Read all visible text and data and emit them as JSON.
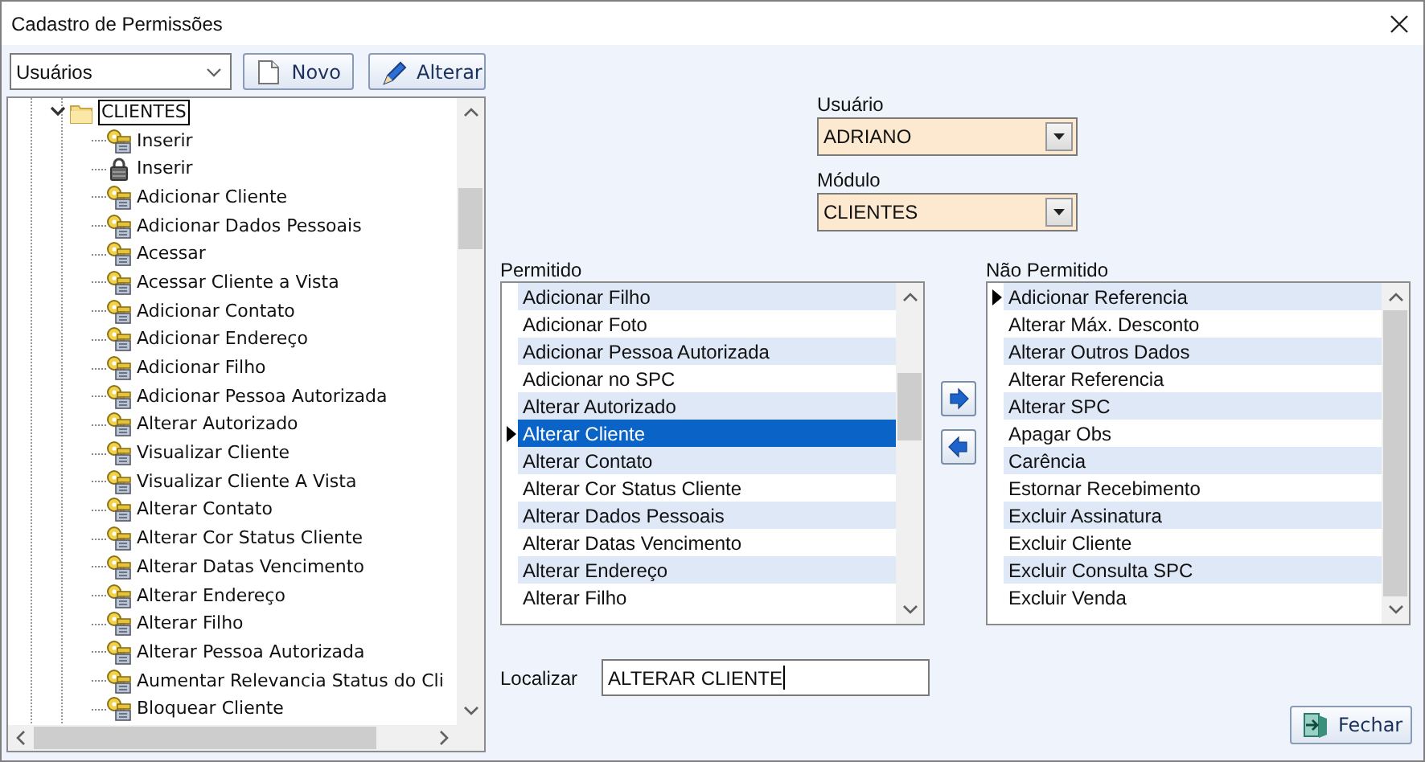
{
  "window": {
    "title": "Cadastro de Permissões"
  },
  "toolbar": {
    "type_combo": {
      "value": "Usuários"
    },
    "buttons": [
      {
        "label": "Novo",
        "kind": "new"
      },
      {
        "label": "Alterar",
        "kind": "edit"
      }
    ]
  },
  "tree": {
    "root": {
      "label": "CLIENTES",
      "expanded": true,
      "selected": true,
      "children": [
        {
          "label": "Inserir",
          "kind": "key",
          "selected": false
        },
        {
          "label": "Inserir",
          "kind": "lock",
          "selected": false
        },
        {
          "label": "Adicionar Cliente",
          "kind": "key",
          "selected": false
        },
        {
          "label": "Adicionar Dados Pessoais",
          "kind": "key",
          "selected": false
        },
        {
          "label": "Acessar",
          "kind": "key",
          "selected": false
        },
        {
          "label": "Acessar Cliente a Vista",
          "kind": "key",
          "selected": false
        },
        {
          "label": "Adicionar Contato",
          "kind": "key",
          "selected": false
        },
        {
          "label": "Adicionar Endereço",
          "kind": "key",
          "selected": false
        },
        {
          "label": "Adicionar Filho",
          "kind": "key",
          "selected": false
        },
        {
          "label": "Adicionar Pessoa Autorizada",
          "kind": "key",
          "selected": false
        },
        {
          "label": "Alterar Autorizado",
          "kind": "key",
          "selected": false
        },
        {
          "label": "Visualizar Cliente",
          "kind": "key",
          "selected": false
        },
        {
          "label": "Visualizar Cliente A Vista",
          "kind": "key",
          "selected": false
        },
        {
          "label": "Alterar Contato",
          "kind": "key",
          "selected": false
        },
        {
          "label": "Alterar Cor Status Cliente",
          "kind": "key",
          "selected": false
        },
        {
          "label": "Alterar Datas Vencimento",
          "kind": "key",
          "selected": false
        },
        {
          "label": "Alterar Endereço",
          "kind": "key",
          "selected": false
        },
        {
          "label": "Alterar Filho",
          "kind": "key",
          "selected": false
        },
        {
          "label": "Alterar Pessoa Autorizada",
          "kind": "key",
          "selected": false
        },
        {
          "label": "Aumentar Relevancia Status do Cli",
          "kind": "key",
          "selected": false
        },
        {
          "label": "Bloquear Cliente",
          "kind": "key",
          "selected": false
        }
      ]
    }
  },
  "usuario": {
    "label": "Usuário",
    "value": "ADRIANO"
  },
  "modulo": {
    "label": "Módulo",
    "value": "CLIENTES"
  },
  "permitido": {
    "label": "Permitido",
    "rows": [
      {
        "text": "Adicionar Filho",
        "selected": false,
        "current": false
      },
      {
        "text": "Adicionar Foto",
        "selected": false,
        "current": false
      },
      {
        "text": "Adicionar Pessoa Autorizada",
        "selected": false,
        "current": false
      },
      {
        "text": "Adicionar no SPC",
        "selected": false,
        "current": false
      },
      {
        "text": "Alterar Autorizado",
        "selected": false,
        "current": false
      },
      {
        "text": "Alterar Cliente",
        "selected": true,
        "current": true
      },
      {
        "text": "Alterar Contato",
        "selected": false,
        "current": false
      },
      {
        "text": "Alterar Cor Status Cliente",
        "selected": false,
        "current": false
      },
      {
        "text": "Alterar Dados Pessoais",
        "selected": false,
        "current": false
      },
      {
        "text": "Alterar Datas Vencimento",
        "selected": false,
        "current": false
      },
      {
        "text": "Alterar Endereço",
        "selected": false,
        "current": false
      },
      {
        "text": "Alterar Filho",
        "selected": false,
        "current": false
      }
    ]
  },
  "transfer_buttons": [
    {
      "kind": "right"
    },
    {
      "kind": "left"
    }
  ],
  "nao_permitido": {
    "label": "Não Permitido",
    "rows": [
      {
        "text": "Adicionar Referencia",
        "selected": false,
        "current": true
      },
      {
        "text": "Alterar Máx. Desconto",
        "selected": false,
        "current": false
      },
      {
        "text": "Alterar Outros Dados",
        "selected": false,
        "current": false
      },
      {
        "text": "Alterar Referencia",
        "selected": false,
        "current": false
      },
      {
        "text": "Alterar SPC",
        "selected": false,
        "current": false
      },
      {
        "text": "Apagar Obs",
        "selected": false,
        "current": false
      },
      {
        "text": "Carência",
        "selected": false,
        "current": false
      },
      {
        "text": "Estornar Recebimento",
        "selected": false,
        "current": false
      },
      {
        "text": "Excluir Assinatura",
        "selected": false,
        "current": false
      },
      {
        "text": "Excluir Cliente",
        "selected": false,
        "current": false
      },
      {
        "text": "Excluir Consulta SPC",
        "selected": false,
        "current": false
      },
      {
        "text": "Excluir Venda",
        "selected": false,
        "current": false
      }
    ]
  },
  "localizar": {
    "label": "Localizar",
    "value": "ALTERAR CLIENTE"
  },
  "close_button": {
    "label": "Fechar"
  }
}
